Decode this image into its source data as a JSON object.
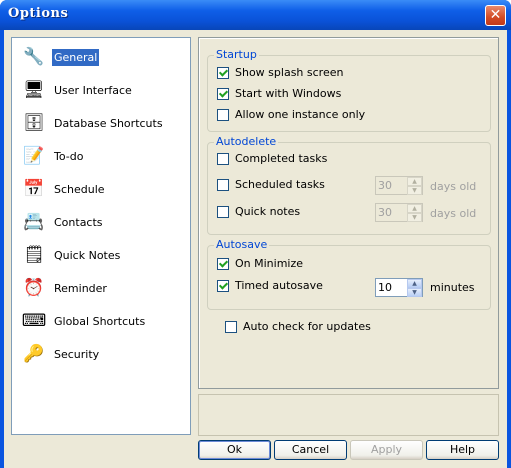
{
  "window": {
    "title": "Options",
    "close_glyph": "✕"
  },
  "sidebar": {
    "items": [
      {
        "label": "General",
        "icon": "wrench-gear-icon",
        "glyph": "🔧",
        "selected": true
      },
      {
        "label": "User Interface",
        "icon": "monitor-icon",
        "glyph": "🖥"
      },
      {
        "label": "Database Shortcuts",
        "icon": "database-icon",
        "glyph": "🗄"
      },
      {
        "label": "To-do",
        "icon": "notepad-pencil-icon",
        "glyph": "📝"
      },
      {
        "label": "Schedule",
        "icon": "calendar-icon",
        "glyph": "📅"
      },
      {
        "label": "Contacts",
        "icon": "contact-card-icon",
        "glyph": "📇"
      },
      {
        "label": "Quick Notes",
        "icon": "sticky-note-icon",
        "glyph": "🗒"
      },
      {
        "label": "Reminder",
        "icon": "alarm-clock-icon",
        "glyph": "⏰"
      },
      {
        "label": "Global Shortcuts",
        "icon": "keyboard-icon",
        "glyph": "⌨"
      },
      {
        "label": "Security",
        "icon": "key-icon",
        "glyph": "🔑"
      }
    ]
  },
  "startup": {
    "title": "Startup",
    "show_splash": {
      "label": "Show splash screen",
      "checked": true
    },
    "start_with_windows": {
      "label": "Start with Windows",
      "checked": true
    },
    "one_instance": {
      "label": "Allow one instance only",
      "checked": false
    }
  },
  "autodelete": {
    "title": "Autodelete",
    "completed_tasks": {
      "label": "Completed tasks",
      "checked": false
    },
    "scheduled_tasks": {
      "label": "Scheduled tasks",
      "checked": false,
      "value": "30",
      "unit": "days old"
    },
    "quick_notes": {
      "label": "Quick notes",
      "checked": false,
      "value": "30",
      "unit": "days old"
    }
  },
  "autosave": {
    "title": "Autosave",
    "on_minimize": {
      "label": "On Minimize",
      "checked": true
    },
    "timed": {
      "label": "Timed autosave",
      "checked": true,
      "value": "10",
      "unit": "minutes"
    }
  },
  "updates": {
    "label": "Auto check for updates",
    "checked": false
  },
  "buttons": {
    "ok": "Ok",
    "cancel": "Cancel",
    "apply": "Apply",
    "help": "Help"
  },
  "colors": {
    "title_bar": "#0a55e0",
    "selection": "#316ac5",
    "group_title": "#0046d5",
    "dialog": "#ece9d8"
  }
}
